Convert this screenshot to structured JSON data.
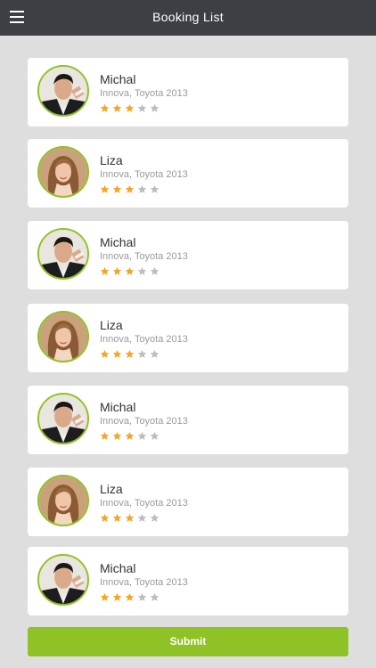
{
  "header": {
    "title": "Booking List",
    "menu_icon": "hamburger-menu-icon"
  },
  "colors": {
    "header_bg": "#3c3f44",
    "accent": "#8fc224",
    "star_filled": "#f5a623",
    "star_empty": "#bdbdbd",
    "page_bg": "#dedede"
  },
  "bookings": [
    {
      "name": "Michal",
      "car": "Innova, Toyota 2013",
      "rating": 3,
      "max_rating": 5,
      "avatar": "male"
    },
    {
      "name": "Liza",
      "car": "Innova, Toyota 2013",
      "rating": 3,
      "max_rating": 5,
      "avatar": "female"
    },
    {
      "name": "Michal",
      "car": "Innova, Toyota 2013",
      "rating": 3,
      "max_rating": 5,
      "avatar": "male"
    },
    {
      "name": "Liza",
      "car": "Innova, Toyota 2013",
      "rating": 3,
      "max_rating": 5,
      "avatar": "female"
    },
    {
      "name": "Michal",
      "car": "Innova, Toyota 2013",
      "rating": 3,
      "max_rating": 5,
      "avatar": "male"
    },
    {
      "name": "Liza",
      "car": "Innova, Toyota 2013",
      "rating": 3,
      "max_rating": 5,
      "avatar": "female"
    },
    {
      "name": "Michal",
      "car": "Innova, Toyota 2013",
      "rating": 3,
      "max_rating": 5,
      "avatar": "male"
    }
  ],
  "submit": {
    "label": "Submit"
  }
}
